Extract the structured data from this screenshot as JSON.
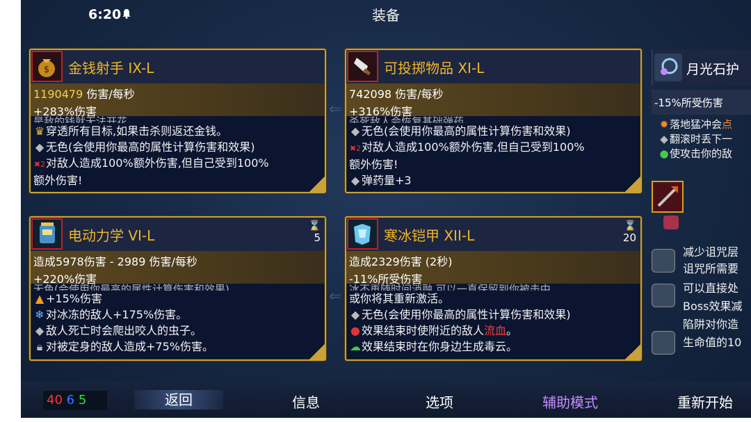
{
  "status": {
    "time": "6:20"
  },
  "title": "装备",
  "cards": [
    {
      "name": "金钱射手 IX-L",
      "dps_value": "1190479",
      "dps_suffix": " 伤害/每秒",
      "bonus": "+283%伤害",
      "ghost": "是敌的钱就无法开花。",
      "lines": [
        "穿透所有目标,如果击杀则返还金钱。",
        "无色(会使用你最高的属性计算伤害和效果)",
        "对敌人造成100%额外伤害,但自己受到100%",
        "额外伤害!"
      ]
    },
    {
      "name": "可投掷物品 XI-L",
      "dps": "742098 伤害/每秒",
      "bonus": "+316%伤害",
      "ghost": "杀死敌人会恢复基础弹药。",
      "lines": [
        "无色(会使用你最高的属性计算伤害和效果)",
        "对敌人造成100%额外伤害,但自己受到100%",
        "额外伤害!",
        "弹药量+3"
      ]
    },
    {
      "name": "电动力学 VI-L",
      "timer": "5",
      "dps": "造成5978伤害 - 2989 伤害/每秒",
      "bonus": "+220%伤害",
      "ghost": "无色(会使用你最高的属性计算伤害和效果)",
      "lines": [
        "+15%伤害",
        "对冰冻的敌人+175%伤害。",
        "敌人死亡时会爬出咬人的虫子。",
        "对被定身的敌人造成+75%伤害。"
      ]
    },
    {
      "name": "寒冰铠甲 XII-L",
      "timer": "20",
      "dps": "造成2329伤害 (2秒)",
      "bonus": "-11%所受伤害",
      "ghost": "冰不再随时间消融,可以一直保留到你被击中",
      "lines_a": "或你将其重新激活。",
      "lines_b": "无色(会使用你最高的属性计算伤害和效果)",
      "lines_c_pre": "效果结束时使附近的敌人",
      "lines_c_red": "流血",
      "lines_c_post": "。",
      "lines_d": "效果结束时在你身边生成毒云。"
    }
  ],
  "side_item": {
    "name": "月光石护",
    "stat": "-15%所受伤害",
    "line1_pre": "落地猛冲会",
    "line1_hl": "点",
    "line2": "翻滚时丢下一",
    "line3": "使攻击你的敌"
  },
  "effects": [
    {
      "l1": "减少诅咒层",
      "l2": "诅咒所需要"
    },
    {
      "l1": "可以直接处",
      "l2": "Boss效果减"
    },
    {
      "l1": "陷阱对你造",
      "l2": "生命值的10"
    }
  ],
  "bottom": {
    "res_red": "40",
    "res_blue": "6",
    "res_green": "5",
    "back": "返回",
    "info": "信息",
    "options": "选项",
    "assist": "辅助模式",
    "restart": "重新开始"
  }
}
